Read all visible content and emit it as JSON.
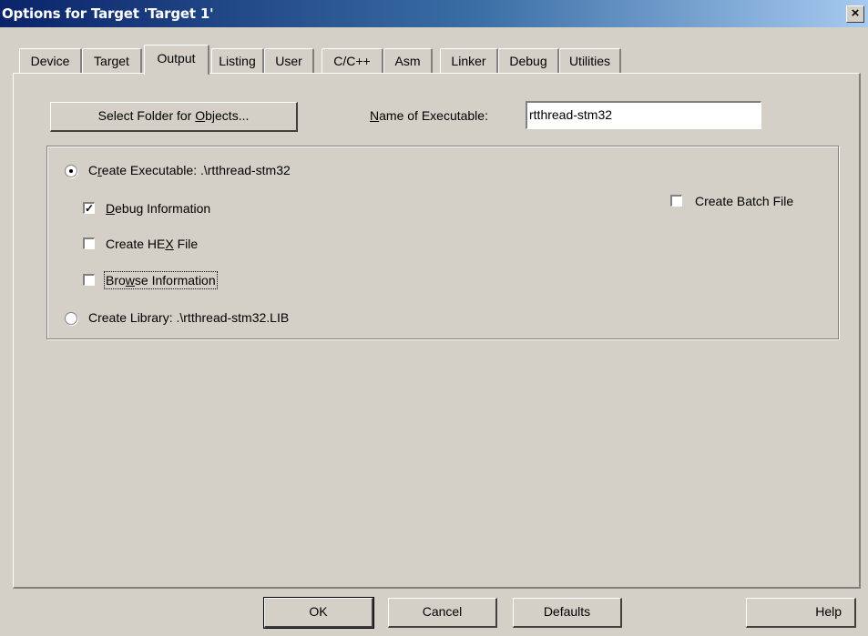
{
  "window": {
    "title": "Options for Target 'Target 1'",
    "close_glyph": "×"
  },
  "tabs": [
    {
      "label": "Device"
    },
    {
      "label": "Target"
    },
    {
      "label": "Output",
      "active": true
    },
    {
      "label": "Listing"
    },
    {
      "label": "User"
    },
    {
      "label": "C/C++"
    },
    {
      "label": "Asm"
    },
    {
      "label": "Linker"
    },
    {
      "label": "Debug"
    },
    {
      "label": "Utilities"
    }
  ],
  "output": {
    "select_folder_label_pre": "Select Folder for ",
    "select_folder_label_key": "O",
    "select_folder_label_post": "bjects...",
    "name_label_key": "N",
    "name_label_rest": "ame of Executable:",
    "name_value": "rtthread-stm32",
    "create_exe": {
      "selected": true,
      "pre": "C",
      "key": "r",
      "post": "eate Executable:  .\\rtthread-stm32"
    },
    "debug_info": {
      "checked": true,
      "key": "D",
      "rest": "ebug Information",
      "check_glyph": "✓"
    },
    "create_hex": {
      "checked": false,
      "pre": "Create HE",
      "key": "X",
      "post": " File"
    },
    "browse_info": {
      "checked": false,
      "pre": "Bro",
      "key": "w",
      "post": "se Information"
    },
    "create_lib": {
      "selected": false,
      "label": "Create Library:  .\\rtthread-stm32.LIB"
    },
    "create_batch": {
      "checked": false,
      "label": "Create Batch File"
    }
  },
  "footer": {
    "ok": "OK",
    "cancel": "Cancel",
    "defaults": "Defaults",
    "help": "Help"
  }
}
